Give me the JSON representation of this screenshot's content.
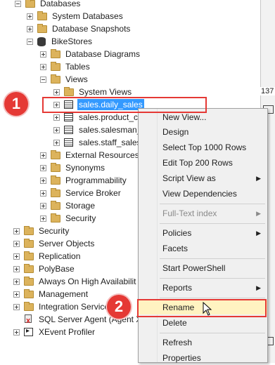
{
  "tree": {
    "databases": "Databases",
    "system_databases": "System Databases",
    "database_snapshots": "Database Snapshots",
    "bikestores": "BikeStores",
    "database_diagrams": "Database Diagrams",
    "tables": "Tables",
    "views": "Views",
    "system_views": "System Views",
    "view_items": [
      "sales.daily_sales",
      "sales.product_c",
      "sales.salesman_",
      "sales.staff_sales"
    ],
    "external_resources": "External Resources",
    "synonyms": "Synonyms",
    "programmability": "Programmability",
    "service_broker": "Service Broker",
    "storage": "Storage",
    "security_db": "Security",
    "security": "Security",
    "server_objects": "Server Objects",
    "replication": "Replication",
    "polybase": "PolyBase",
    "always_on": "Always On High Availabilit",
    "management": "Management",
    "integration_services": "Integration Service",
    "sql_agent": "SQL Server Agent (Agent X",
    "xevent_profiler": "XEvent Profiler"
  },
  "right_pane": {
    "number": "137"
  },
  "context_menu": {
    "items": [
      "New View...",
      "Design",
      "Select Top 1000 Rows",
      "Edit Top 200 Rows",
      "Script View as",
      "View Dependencies",
      "Full-Text index",
      "Policies",
      "Facets",
      "Start PowerShell",
      "Reports",
      "Rename",
      "Delete",
      "Refresh",
      "Properties"
    ]
  },
  "callouts": {
    "step1": "1",
    "step2": "2"
  },
  "colors": {
    "selection": "#3399ff",
    "callout": "#e53935",
    "highlight": "#fff3c1",
    "folder": "#dcb35c"
  }
}
